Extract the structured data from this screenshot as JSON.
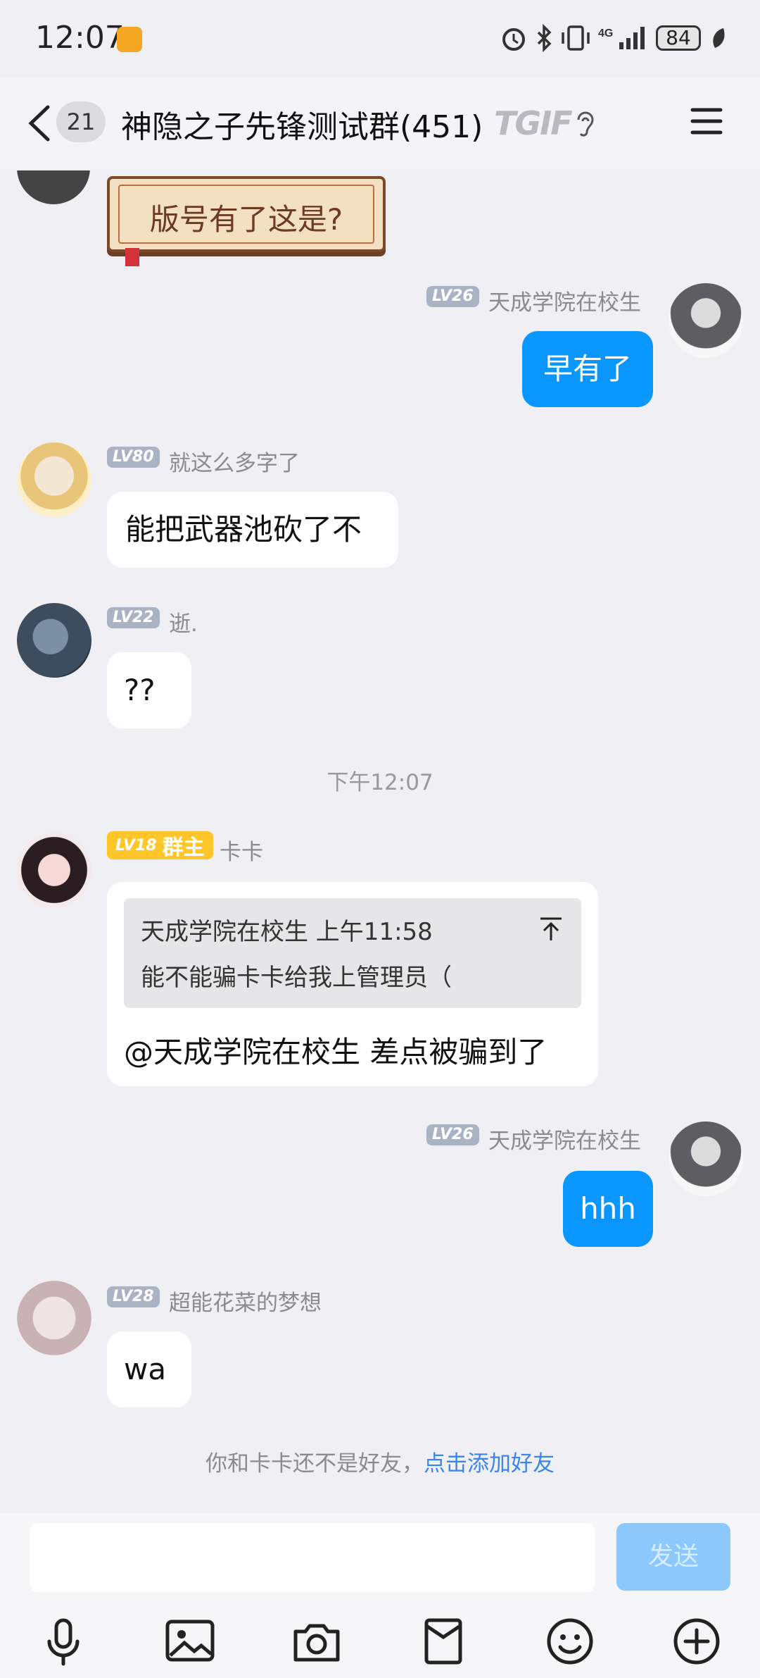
{
  "status_bar": {
    "time": "12:07",
    "battery": "84",
    "icons": [
      "alarm-icon",
      "bluetooth-icon",
      "vibrate-icon",
      "signal-4g-icon",
      "battery-icon",
      "leaf-icon"
    ]
  },
  "header": {
    "unread_count": "21",
    "title": "神隐之子先锋测试群(451)",
    "logo_text": "TGIF",
    "icons": [
      "back-icon",
      "ear-icon",
      "menu-icon"
    ]
  },
  "messages": [
    {
      "id": "m0",
      "side": "left",
      "text": "版号有了这是?",
      "style": "scroll-sticker"
    },
    {
      "id": "m1",
      "side": "right",
      "level": "LV26",
      "name": "天成学院在校生",
      "text": "早有了"
    },
    {
      "id": "m2",
      "side": "left",
      "level": "LV80",
      "name": "就这么多字了",
      "text": "能把武器池砍了不"
    },
    {
      "id": "m3",
      "side": "left",
      "level": "LV22",
      "name": "逝.",
      "text": "??"
    },
    {
      "id": "m4",
      "side": "left",
      "level": "LV18",
      "role": "群主",
      "name": "卡卡",
      "quote_header": "天成学院在校生 上午11:58",
      "quote_text": "能不能骗卡卡给我上管理员（",
      "text": "@天成学院在校生 差点被骗到了"
    },
    {
      "id": "m5",
      "side": "right",
      "level": "LV26",
      "name": "天成学院在校生",
      "text": "hhh"
    },
    {
      "id": "m6",
      "side": "left",
      "level": "LV28",
      "name": "超能花菜的梦想",
      "text": "wa"
    }
  ],
  "time_divider": "下午12:07",
  "friend_hint": {
    "prefix": "你和卡卡还不是好友，",
    "link": "点击添加好友"
  },
  "composer": {
    "input_value": "",
    "send_label": "发送",
    "tools": [
      "microphone-icon",
      "image-icon",
      "camera-icon",
      "red-packet-icon",
      "emoji-icon",
      "plus-icon"
    ]
  },
  "colors": {
    "accent": "#0a96ff",
    "owner_badge": "#ffc62a",
    "level_badge": "#aab3c4"
  }
}
